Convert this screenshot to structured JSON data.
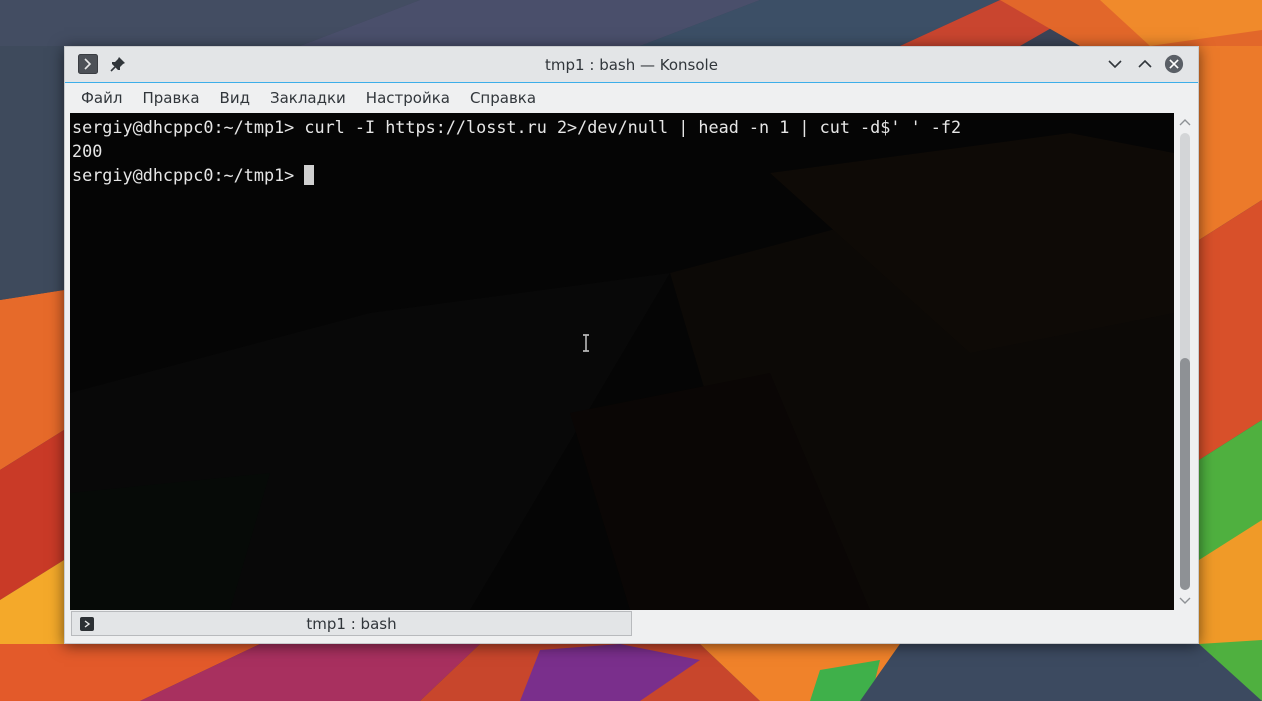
{
  "window": {
    "title": "tmp1 : bash — Konsole",
    "accent_color": "#3daee9"
  },
  "titlebar_buttons": {
    "menu_icon": "terminal-prompt-icon",
    "pin_icon": "pin-icon",
    "minimize_icon": "chevron-down-icon",
    "maximize_icon": "chevron-up-icon",
    "close_icon": "close-icon"
  },
  "menu": {
    "items": [
      {
        "label": "Файл"
      },
      {
        "label": "Правка"
      },
      {
        "label": "Вид"
      },
      {
        "label": "Закладки"
      },
      {
        "label": "Настройка"
      },
      {
        "label": "Справка"
      }
    ]
  },
  "terminal": {
    "lines": [
      {
        "text": "sergiy@dhcppc0:~/tmp1> curl -I https://losst.ru 2>/dev/null | head -n 1 | cut -d$' ' -f2"
      },
      {
        "text": "200"
      },
      {
        "text": "sergiy@dhcppc0:~/tmp1> "
      }
    ],
    "text_color": "#e6e6e6",
    "background_color": "#050505"
  },
  "scrollbar": {
    "position_fraction": 1.0
  },
  "tab": {
    "label": "tmp1 : bash",
    "icon": "terminal-prompt-icon"
  }
}
